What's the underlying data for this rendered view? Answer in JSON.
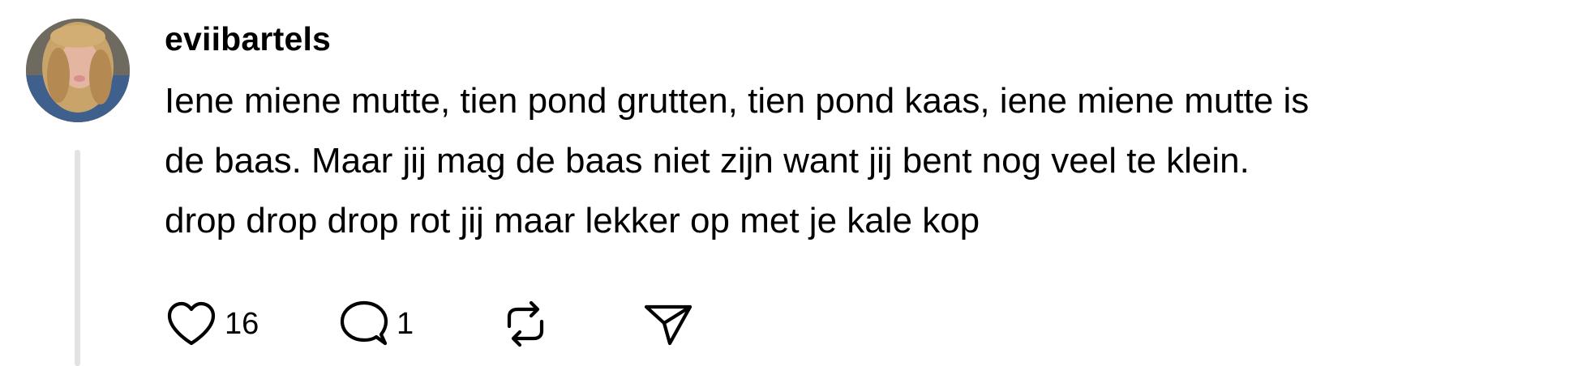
{
  "post": {
    "username": "eviibartels",
    "lines": [
      "Iene miene mutte, tien pond grutten, tien pond kaas, iene miene mutte is",
      "de baas. Maar jij mag de baas niet zijn want jij bent nog veel te klein.",
      "drop drop drop rot jij maar lekker op met je kale kop"
    ]
  },
  "actions": {
    "like": {
      "icon": "heart-icon",
      "count": "16"
    },
    "reply": {
      "icon": "comment-bubble-icon",
      "count": "1"
    },
    "repost": {
      "icon": "repost-icon"
    },
    "share": {
      "icon": "send-icon"
    }
  }
}
